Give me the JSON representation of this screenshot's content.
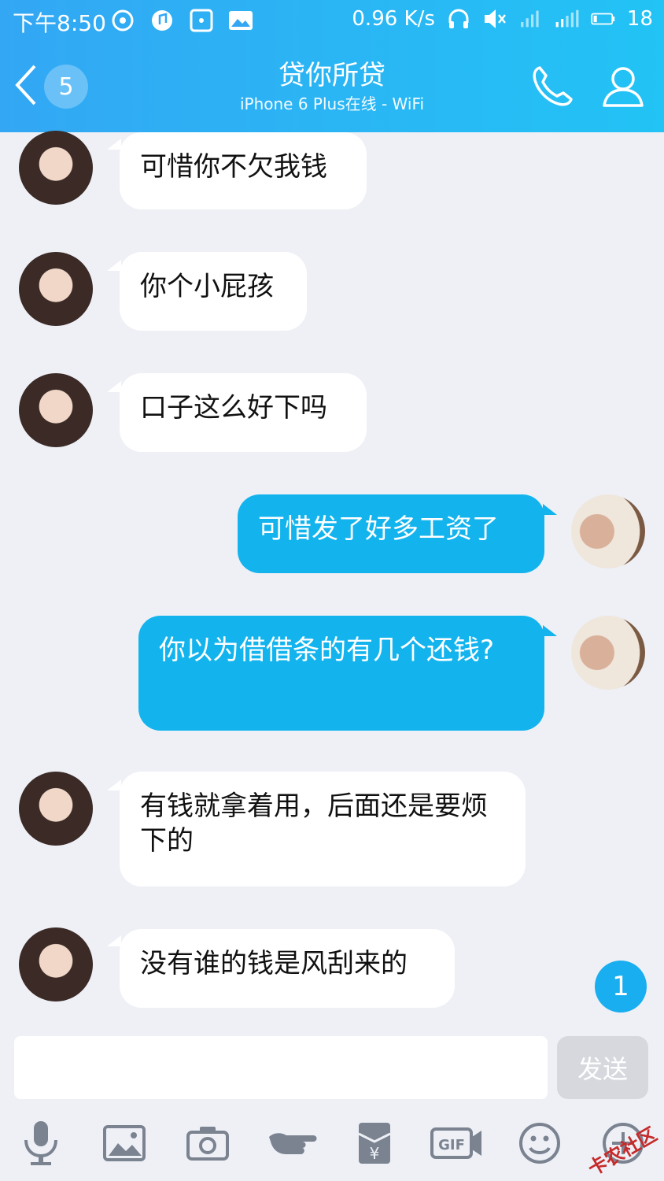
{
  "status": {
    "time": "下午8:50",
    "speed": "0.96 K/s",
    "battery": "18"
  },
  "nav": {
    "unread_count": "5",
    "title": "贷你所贷",
    "subtitle": "iPhone 6 Plus在线 - WiFi"
  },
  "messages": [
    {
      "side": "in",
      "text": "可惜你不欠我钱"
    },
    {
      "side": "in",
      "text": "你个小屁孩"
    },
    {
      "side": "in",
      "text": "口子这么好下吗"
    },
    {
      "side": "out",
      "text": "可惜发了好多工资了"
    },
    {
      "side": "out",
      "text": "你以为借借条的有几个还钱?"
    },
    {
      "side": "in",
      "text": "有钱就拿着用，后面还是要烦下的"
    },
    {
      "side": "in",
      "text": "没有谁的钱是风刮来的"
    }
  ],
  "new_message_badge": "1",
  "input": {
    "value": "",
    "send_label": "发送"
  },
  "toolbar_gif_label": "GIF",
  "watermark": "卡农社区",
  "colors": {
    "header_start": "#33a7f4",
    "header_end": "#22c3f5",
    "bubble_out": "#13b4ee",
    "bubble_in": "#ffffff",
    "background": "#eef0f6"
  }
}
